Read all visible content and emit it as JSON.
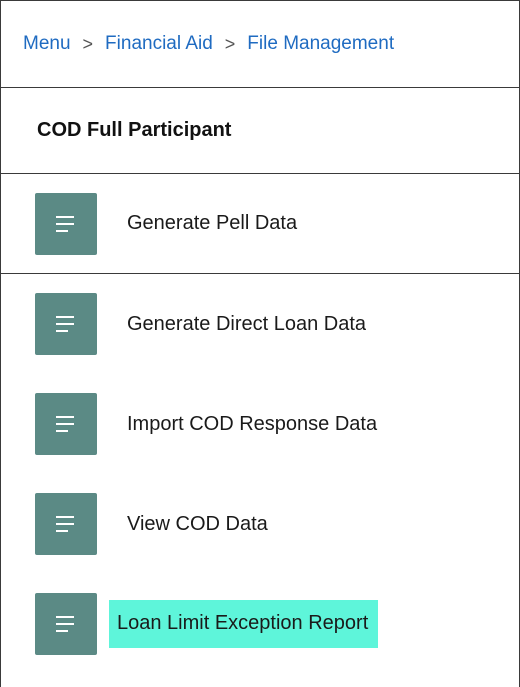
{
  "breadcrumb": {
    "items": [
      "Menu",
      "Financial Aid",
      "File Management"
    ],
    "separator": ">"
  },
  "section": {
    "title": "COD Full Participant"
  },
  "menu": {
    "items": [
      {
        "label": "Generate Pell Data",
        "icon": "document-lines-icon"
      },
      {
        "label": "Generate Direct Loan Data",
        "icon": "document-lines-icon"
      },
      {
        "label": "Import COD Response Data",
        "icon": "document-lines-icon"
      },
      {
        "label": "View COD Data",
        "icon": "document-lines-icon"
      },
      {
        "label": "Loan Limit Exception Report",
        "icon": "document-lines-icon",
        "highlighted": true
      }
    ]
  },
  "colors": {
    "link": "#1f6bc1",
    "icon_tile": "#5b8a85",
    "highlight": "#5ef5da",
    "border": "#3a3a3a"
  }
}
